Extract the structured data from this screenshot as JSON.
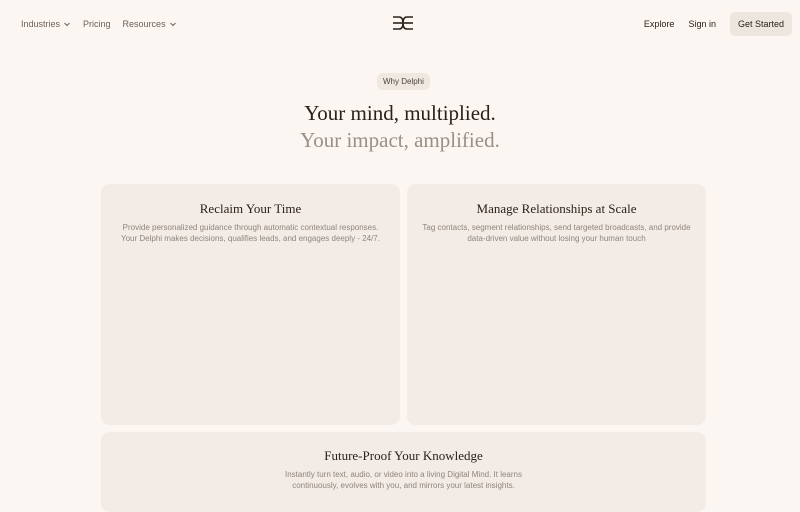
{
  "nav": {
    "industries": "Industries",
    "pricing": "Pricing",
    "resources": "Resources",
    "explore": "Explore",
    "sign_in": "Sign in",
    "get_started": "Get Started",
    "logo_icon": "delphi-logo-icon",
    "chevron_icon": "chevron-down-icon"
  },
  "hero": {
    "badge": "Why Delphi",
    "headline_line1": "Your mind, multiplied.",
    "headline_line2": "Your impact, amplified."
  },
  "cards": [
    {
      "title": "Reclaim Your Time",
      "description": "Provide personalized guidance through automatic contextual responses. Your Delphi makes decisions, qualifies leads, and engages deeply - 24/7."
    },
    {
      "title": "Manage Relationships at Scale",
      "description": "Tag contacts, segment relationships, send targeted broadcasts, and provide data-driven value without losing your human touch"
    },
    {
      "title": "Future-Proof Your Knowledge",
      "description": "Instantly turn text, audio, or video into a living Digital Mind. It learns continuously, evolves with you, and mirrors your latest insights."
    }
  ],
  "colors": {
    "background": "#fbf6f1",
    "card": "#f3ece6",
    "text": "#2b211a",
    "muted": "#9a8f86"
  }
}
